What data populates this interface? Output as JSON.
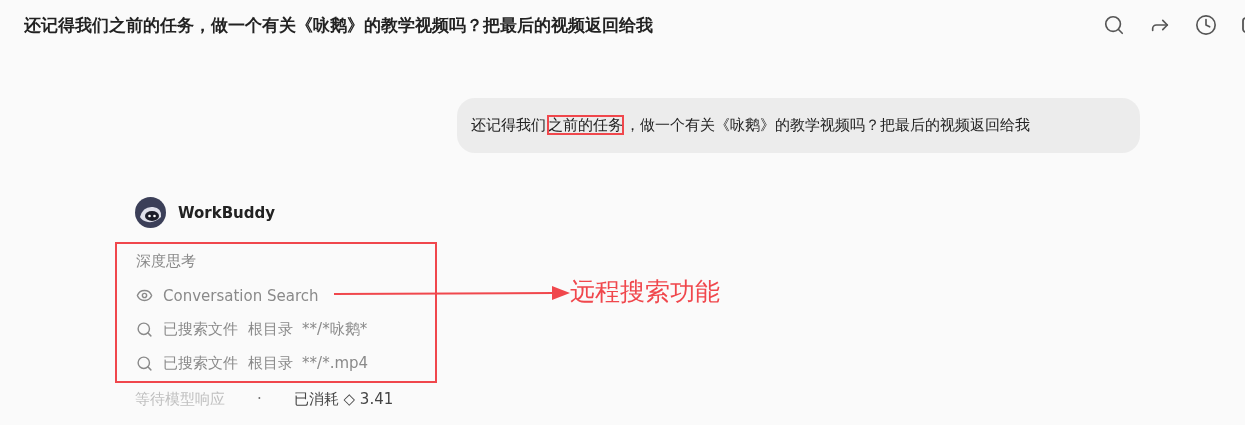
{
  "header": {
    "title": "还记得我们之前的任务，做一个有关《咏鹅》的教学视频吗？把最后的视频返回给我"
  },
  "user_message": {
    "parts": [
      {
        "text": "还记得我们",
        "highlighted": false
      },
      {
        "text": "之前的任务",
        "highlighted": true
      },
      {
        "text": "，做一个有关《咏鹅》的教学视频吗？把最后的视频返回给我",
        "highlighted": false
      }
    ]
  },
  "assistant": {
    "name": "WorkBuddy",
    "steps": [
      {
        "kind": "heading",
        "label": "深度思考"
      },
      {
        "kind": "view",
        "label": "Conversation Search"
      },
      {
        "kind": "search",
        "label": "已搜索文件",
        "scope": "根目录",
        "pattern": "**/*咏鹅*"
      },
      {
        "kind": "search",
        "label": "已搜索文件",
        "scope": "根目录",
        "pattern": "**/*.mp4"
      }
    ],
    "status": {
      "waiting": "等待模型响应",
      "separator": "·",
      "cost": "已消耗 ◇ 3.41"
    }
  },
  "annotation": {
    "label": "远程搜索功能"
  }
}
